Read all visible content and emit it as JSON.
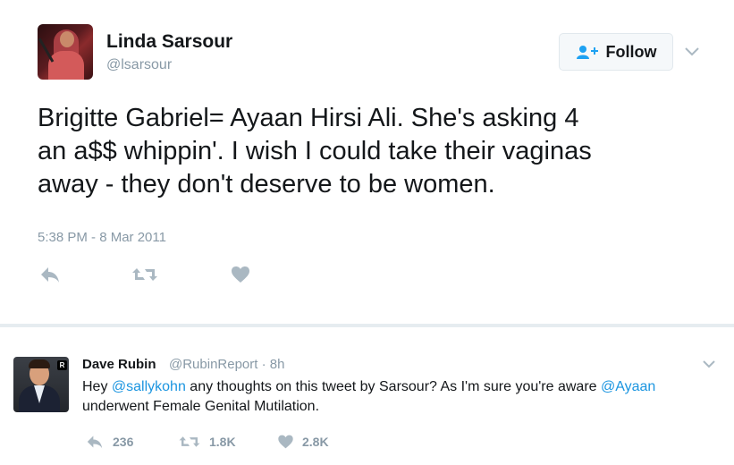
{
  "tweet": {
    "author_name": "Linda Sarsour",
    "author_handle": "@lsarsour",
    "follow_label": "Follow",
    "text": "Brigitte Gabriel= Ayaan Hirsi Ali. She's asking 4\nan a$$ whippin'. I wish I could take their vaginas\naway - they don't deserve to be women.",
    "timestamp": "5:38 PM - 8 Mar 2011",
    "icons": [
      "reply-icon",
      "retweet-icon",
      "heart-icon",
      "follow-person-icon",
      "chevron-down-icon"
    ]
  },
  "reply": {
    "author_name": "Dave Rubin",
    "author_handle": "@RubinReport",
    "separator": " · ",
    "time": "8h",
    "text_parts": {
      "hey": "Hey ",
      "mention1": "@sallykohn",
      "middle": " any thoughts on this tweet by Sarsour? As I'm sure you're aware ",
      "mention2": "@Ayaan",
      "end": " underwent Female Genital Mutilation."
    },
    "avatar_badge": "R",
    "reply_count": "236",
    "retweet_count": "1.8K",
    "like_count": "2.8K"
  },
  "colors": {
    "text": "#14171a",
    "secondary": "#8899a6",
    "link": "#1b95e0",
    "follow_icon": "#1da1f2",
    "divider": "#e6ecf0"
  }
}
